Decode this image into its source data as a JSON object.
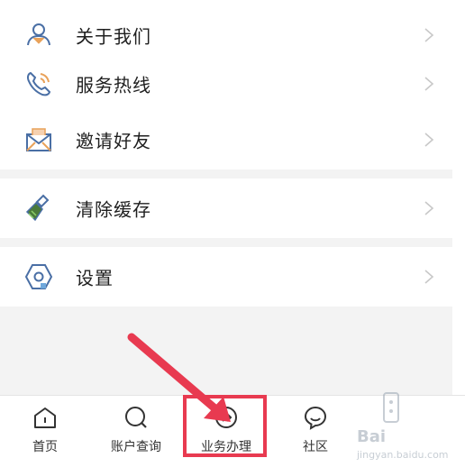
{
  "menu": {
    "group1": [
      {
        "label": "关于我们",
        "icon": "about-us-icon"
      },
      {
        "label": "服务热线",
        "icon": "phone-icon"
      },
      {
        "label": "邀请好友",
        "icon": "invite-mail-icon"
      }
    ],
    "group2": [
      {
        "label": "清除缓存",
        "icon": "broom-icon"
      }
    ],
    "group3": [
      {
        "label": "设置",
        "icon": "settings-hexagon-icon"
      }
    ]
  },
  "tabbar": {
    "tabs": [
      {
        "label": "首页",
        "icon": "home-icon"
      },
      {
        "label": "账户查询",
        "icon": "search-icon"
      },
      {
        "label": "业务办理",
        "icon": "business-handling-icon"
      },
      {
        "label": "社区",
        "icon": "community-chat-icon"
      }
    ],
    "highlighted_tab": "业务办理"
  },
  "watermark": {
    "text": "Bai",
    "sub": "jingyan.baidu.com"
  },
  "colors": {
    "icon_blue": "#4a6fa5",
    "accent_red": "#e83a50",
    "chevron": "#c8c8c8",
    "page_bg": "#f3f3f3"
  }
}
